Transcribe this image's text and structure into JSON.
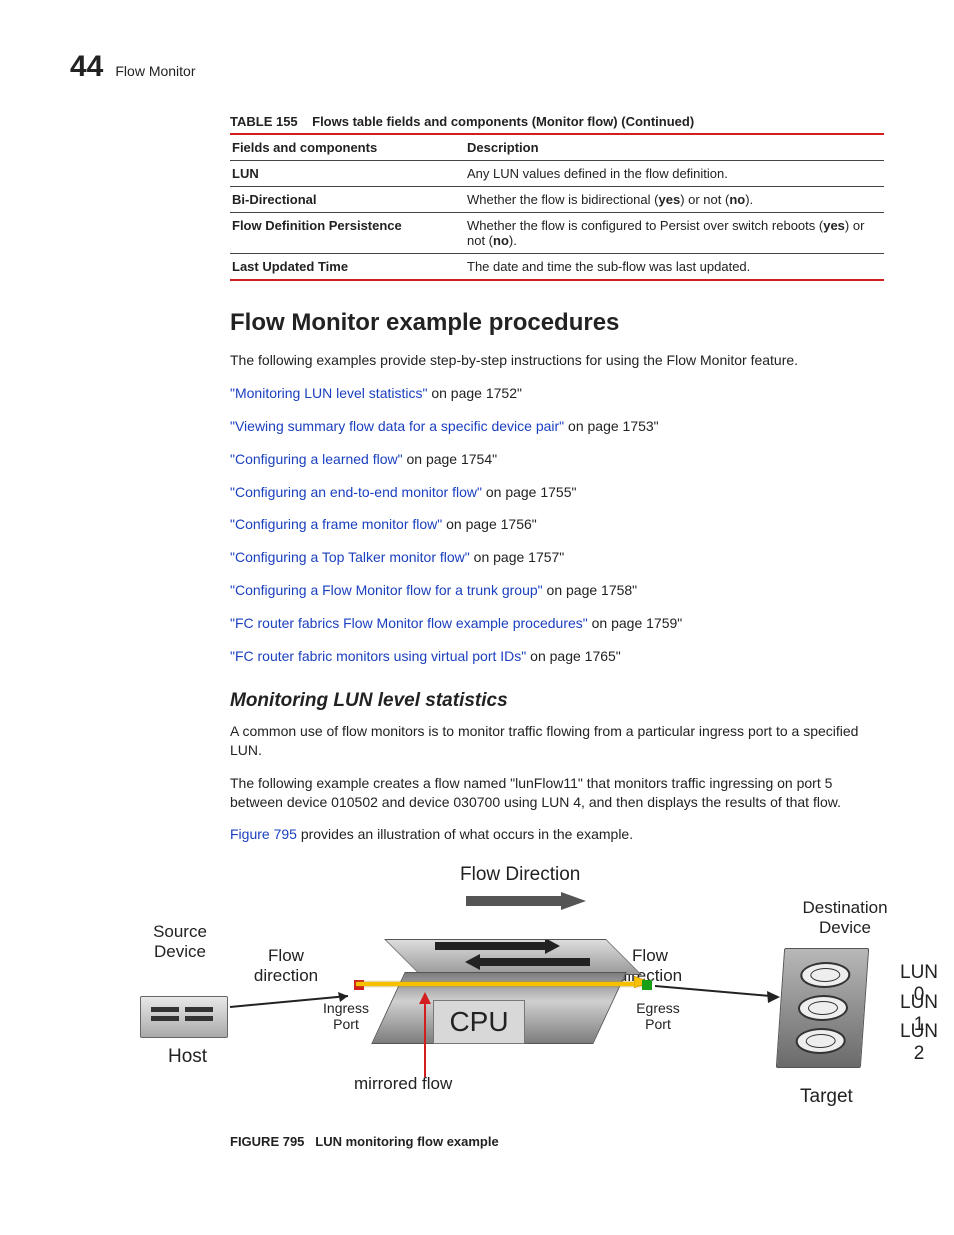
{
  "header": {
    "page_number": "44",
    "title": "Flow Monitor"
  },
  "table": {
    "caption_label": "TABLE 155",
    "caption_text": "Flows table fields and components (Monitor flow) (Continued)",
    "col1": "Fields and components",
    "col2": "Description",
    "rows": [
      {
        "field": "LUN",
        "desc": "Any LUN values defined in the flow definition."
      },
      {
        "field": "Bi-Directional",
        "desc_pre": "Whether the flow is bidirectional (",
        "b1": "yes",
        "desc_mid": ") or not (",
        "b2": "no",
        "desc_post": ")."
      },
      {
        "field": "Flow Definition Persistence",
        "desc_pre": "Whether the flow is configured to Persist over switch reboots (",
        "b1": "yes",
        "desc_mid": ") or not (",
        "b2": "no",
        "desc_post": ")."
      },
      {
        "field": "Last Updated Time",
        "desc": "The date and time the sub-flow was last updated."
      }
    ]
  },
  "section1": {
    "heading": "Flow Monitor example procedures",
    "intro": "The following examples provide step-by-step instructions for using the Flow Monitor feature.",
    "links": [
      {
        "text": "\"Monitoring LUN level statistics\"",
        "suffix": " on page 1752\""
      },
      {
        "text": "\"Viewing summary flow data for a specific device pair\"",
        "suffix": " on page 1753\""
      },
      {
        "text": "\"Configuring a learned flow\"",
        "suffix": " on page 1754\""
      },
      {
        "text": "\"Configuring an end-to-end monitor flow\"",
        "suffix": " on page 1755\""
      },
      {
        "text": "\"Configuring a frame monitor flow\"",
        "suffix": " on page 1756\""
      },
      {
        "text": "\"Configuring a Top Talker monitor flow\"",
        "suffix": " on page 1757\""
      },
      {
        "text": "\"Configuring a Flow Monitor flow for a trunk group\"",
        "suffix": " on page 1758\""
      },
      {
        "text": "\"FC router fabrics Flow Monitor flow example procedures\"",
        "suffix": " on page 1759\""
      },
      {
        "text": "\"FC router fabric monitors using virtual port IDs\"",
        "suffix": " on page 1765\""
      }
    ]
  },
  "section2": {
    "heading": "Monitoring LUN level statistics",
    "p1": "A common use of flow monitors is to monitor traffic flowing from a particular ingress port to a specified LUN.",
    "p2": "The following example creates a flow named \"lunFlow11\" that monitors traffic ingressing on port 5 between device 010502 and device 030700 using LUN 4, and then displays the results of that flow.",
    "p3_link": "Figure 795",
    "p3_rest": " provides an illustration of what occurs in the example."
  },
  "figure": {
    "flow_direction_top": "Flow Direction",
    "source_device": "Source Device",
    "destination_device": "Destination Device",
    "flow_direction_left": "Flow direction",
    "flow_direction_right": "Flow direction",
    "ingress": "Ingress Port",
    "egress": "Egress Port",
    "cpu": "CPU",
    "mirrored": "mirrored flow",
    "host": "Host",
    "target": "Target",
    "lun0": "LUN 0",
    "lun1": "LUN 1",
    "lun2": "LUN 2",
    "caption_label": "FIGURE 795",
    "caption_text": "LUN monitoring flow example"
  }
}
